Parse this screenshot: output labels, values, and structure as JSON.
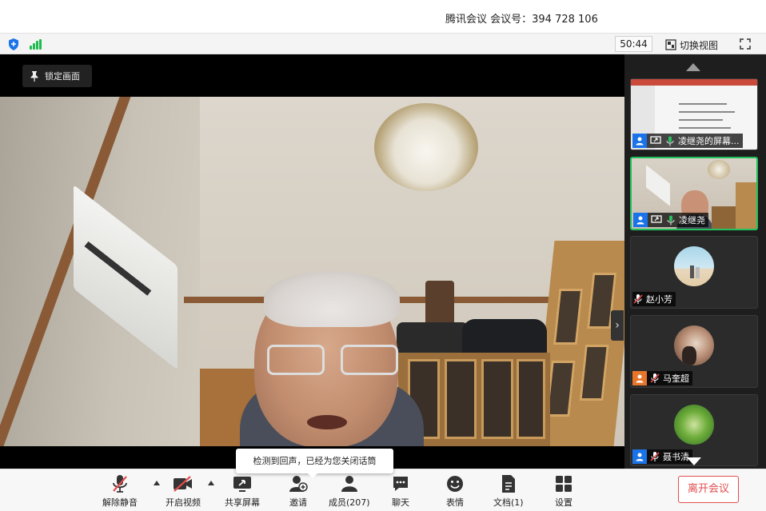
{
  "window": {
    "title": "腾讯会议 会议号：394 728 106"
  },
  "infobar": {
    "timer": "50:44",
    "switch_view_label": "切换视图"
  },
  "main_video": {
    "lock_label": "锁定画面"
  },
  "sidebar": {
    "participants": [
      {
        "name": "凌继尧的屏幕...",
        "kind": "screen-share",
        "muted": false
      },
      {
        "name": "凌继尧",
        "kind": "video",
        "muted": false,
        "active": true
      },
      {
        "name": "赵小芳",
        "kind": "avatar",
        "muted": true
      },
      {
        "name": "马奎超",
        "kind": "avatar",
        "muted": true
      },
      {
        "name": "聂书清",
        "kind": "avatar",
        "muted": true
      }
    ]
  },
  "toolbar": {
    "unmute_label": "解除静音",
    "start_video_label": "开启视频",
    "share_screen_label": "共享屏幕",
    "invite_label": "邀请",
    "members_label": "成员(207)",
    "chat_label": "聊天",
    "reactions_label": "表情",
    "docs_label": "文档(1)",
    "settings_label": "设置",
    "leave_label": "离开会议"
  },
  "tooltip": {
    "text": "检测到回声，已经为您关闭话筒"
  },
  "colors": {
    "accent_green": "#22c15e",
    "brand_blue": "#1a73e8",
    "danger_red": "#e24c4c"
  }
}
